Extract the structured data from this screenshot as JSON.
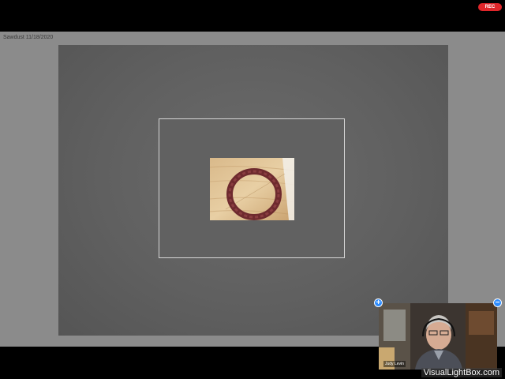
{
  "recording": {
    "badge_label": "REC"
  },
  "shared_screen": {
    "title": "Sawdust 11/18/2020"
  },
  "slide": {
    "photo_icon": "bowl-ring-photo"
  },
  "video_tile": {
    "participant_name": "Judy Levin",
    "expand_icon": "plus-icon",
    "collapse_icon": "minus-icon",
    "expand_label": "+",
    "collapse_label": "−"
  },
  "watermark": {
    "text": "VisualLightBox.com"
  },
  "colors": {
    "background": "#000000",
    "share_area": "#8b8b8b",
    "slide": "#606060",
    "rec": "#e0262a",
    "accent": "#2d8cff"
  }
}
